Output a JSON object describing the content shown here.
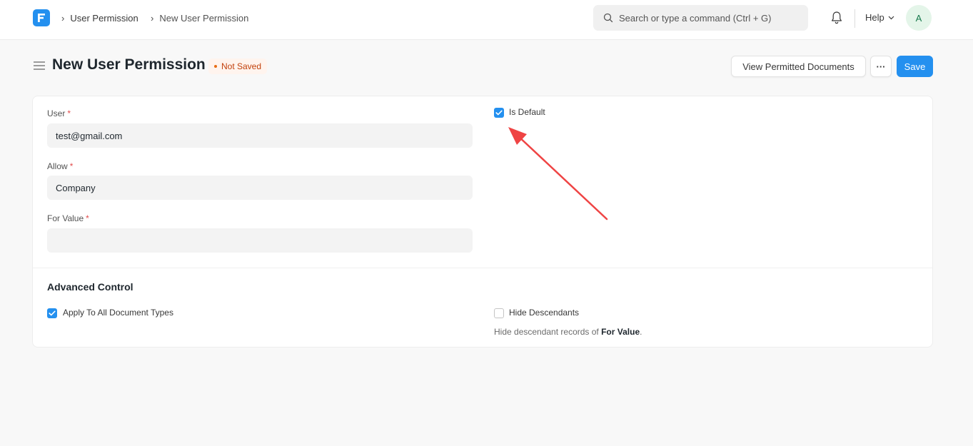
{
  "navbar": {
    "breadcrumbs": [
      "User Permission",
      "New User Permission"
    ],
    "search_placeholder": "Search or type a command (Ctrl + G)",
    "help_label": "Help",
    "avatar_initial": "A"
  },
  "page": {
    "title": "New User Permission",
    "status": "Not Saved",
    "actions": {
      "view_permitted": "View Permitted Documents",
      "more": "···",
      "save": "Save"
    }
  },
  "form": {
    "user": {
      "label": "User",
      "value": "test@gmail.com",
      "required": "*"
    },
    "allow": {
      "label": "Allow",
      "value": "Company",
      "required": "*"
    },
    "for_value": {
      "label": "For Value",
      "value": "",
      "required": "*"
    },
    "is_default": {
      "label": "Is Default",
      "checked": true
    }
  },
  "advanced": {
    "title": "Advanced Control",
    "apply_all": {
      "label": "Apply To All Document Types",
      "checked": true
    },
    "hide_descendants": {
      "label": "Hide Descendants",
      "checked": false
    },
    "hide_desc_text_prefix": "Hide descendant records of ",
    "hide_desc_text_bold": "For Value",
    "hide_desc_text_suffix": "."
  },
  "colors": {
    "primary": "#2490ef",
    "annotation_arrow": "#ef4444",
    "status": "#c2410c"
  }
}
